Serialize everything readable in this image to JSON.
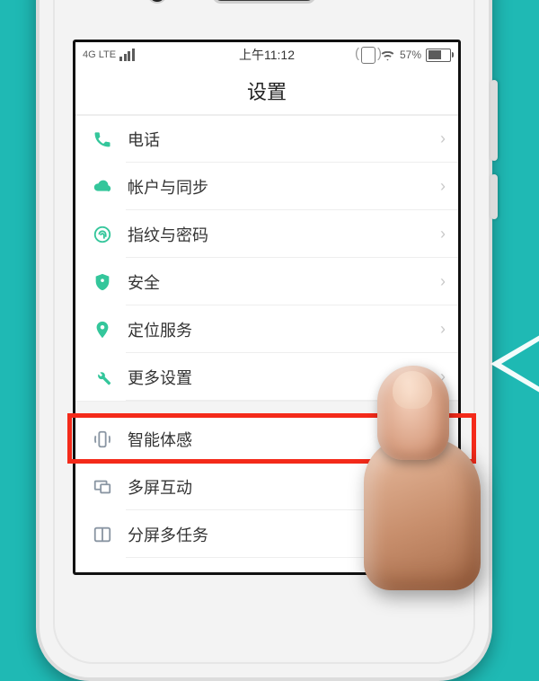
{
  "status": {
    "network": "4G LTE",
    "time": "上午11:12",
    "battery_pct": "57%"
  },
  "header": {
    "title": "设置"
  },
  "rows": {
    "phone": {
      "label": "电话"
    },
    "sync": {
      "label": "帐户与同步"
    },
    "fingerprint": {
      "label": "指纹与密码"
    },
    "security": {
      "label": "安全"
    },
    "location": {
      "label": "定位服务"
    },
    "more": {
      "label": "更多设置"
    },
    "motion": {
      "label": "智能体感"
    },
    "multiscreen": {
      "label": "多屏互动"
    },
    "splitview": {
      "label": "分屏多任务"
    }
  },
  "highlight_target": "motion"
}
